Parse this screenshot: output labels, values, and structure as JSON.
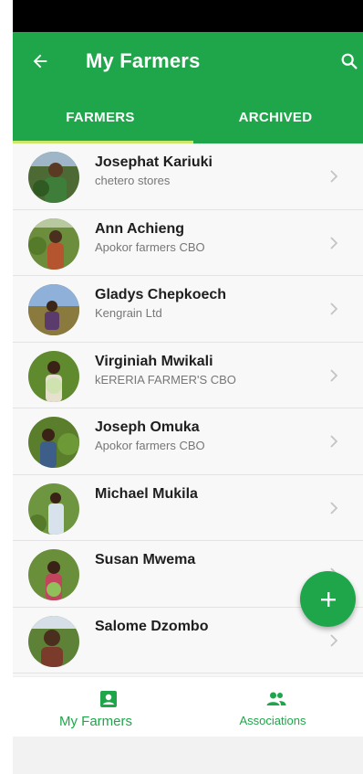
{
  "header": {
    "title": "My Farmers"
  },
  "tabs": [
    {
      "label": "FARMERS",
      "selected": true
    },
    {
      "label": "ARCHIVED",
      "selected": false
    }
  ],
  "farmers": [
    {
      "name": "Josephat Kariuki",
      "org": "chetero stores"
    },
    {
      "name": "Ann Achieng",
      "org": "Apokor farmers CBO"
    },
    {
      "name": "Gladys Chepkoech",
      "org": "Kengrain Ltd"
    },
    {
      "name": "Virginiah Mwikali",
      "org": "kERERIA FARMER'S CBO"
    },
    {
      "name": "Joseph Omuka",
      "org": "Apokor farmers CBO"
    },
    {
      "name": "Michael Mukila",
      "org": ""
    },
    {
      "name": "Susan Mwema",
      "org": ""
    },
    {
      "name": "Salome Dzombo",
      "org": ""
    }
  ],
  "bottom_nav": [
    {
      "label": "My Farmers",
      "icon": "account-box-icon",
      "selected": true
    },
    {
      "label": "Associations",
      "icon": "people-icon",
      "selected": false
    }
  ],
  "fab": {
    "icon": "plus-icon"
  },
  "colors": {
    "primary": "#1fa64a",
    "indicator": "#cbe86b"
  }
}
